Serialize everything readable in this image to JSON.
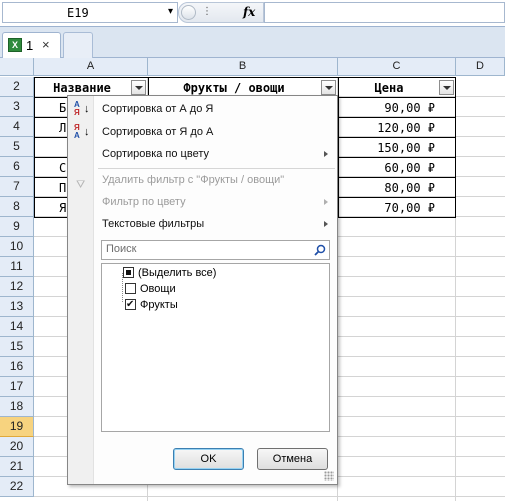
{
  "formula_bar": {
    "name_box": "E19",
    "dots": "⋮",
    "fx_label": "fx",
    "formula": ""
  },
  "workbook_tab": {
    "label": "1",
    "close": "×",
    "excel_icon_letter": "X"
  },
  "columns": [
    "A",
    "B",
    "C",
    "D"
  ],
  "rows": [
    "2",
    "3",
    "4",
    "5",
    "6",
    "7",
    "8",
    "9",
    "10",
    "11",
    "12",
    "13",
    "14",
    "15",
    "16",
    "17",
    "18",
    "19",
    "20",
    "21",
    "22"
  ],
  "active_row": "19",
  "table": {
    "headers": [
      "Название",
      "Фрукты / овощи",
      "Цена"
    ],
    "partial_names": [
      "Б",
      "Л",
      "",
      "С",
      "По",
      "Я"
    ],
    "prices": [
      "90,00 ₽",
      "120,00 ₽",
      "150,00 ₽",
      "60,00 ₽",
      "80,00 ₽",
      "70,00 ₽"
    ]
  },
  "filter_menu": {
    "sort_asc": "Сортировка от А до Я",
    "sort_desc": "Сортировка от Я до А",
    "sort_by_color": "Сортировка по цвету",
    "clear_filter": "Удалить фильтр с \"Фрукты / овощи\"",
    "filter_by_color": "Фильтр по цвету",
    "text_filters": "Текстовые фильтры",
    "search_placeholder": "Поиск",
    "items": [
      {
        "label": "(Выделить все)",
        "state": "partial"
      },
      {
        "label": "Овощи",
        "state": "unchecked"
      },
      {
        "label": "Фрукты",
        "state": "checked"
      }
    ],
    "ok": "OK",
    "cancel": "Отмена"
  },
  "colors": {
    "header_bg": "#e4ecf7",
    "active_row_bg": "#f7d37f",
    "excel_green": "#2f8a3c",
    "sort_icon_blue": "#1f4fa8",
    "sort_icon_red": "#c0282a"
  }
}
